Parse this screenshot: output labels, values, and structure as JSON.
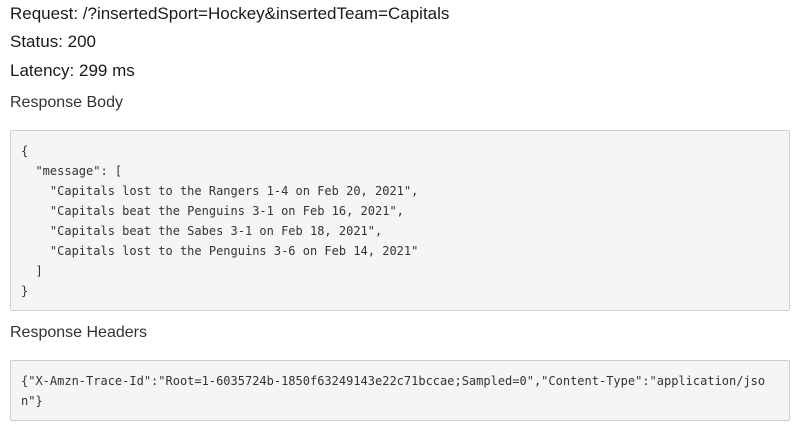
{
  "request": {
    "label": "Request: /?insertedSport=Hockey&insertedTeam=Capitals"
  },
  "status": {
    "label": "Status: 200"
  },
  "latency": {
    "label": "Latency: 299 ms"
  },
  "response_body": {
    "title": "Response Body",
    "code": "{\n  \"message\": [\n    \"Capitals lost to the Rangers 1-4 on Feb 20, 2021\",\n    \"Capitals beat the Penguins 3-1 on Feb 16, 2021\",\n    \"Capitals beat the Sabes 3-1 on Feb 18, 2021\",\n    \"Capitals lost to the Penguins 3-6 on Feb 14, 2021\"\n  ]\n}"
  },
  "response_headers": {
    "title": "Response Headers",
    "code": "{\"X-Amzn-Trace-Id\":\"Root=1-6035724b-1850f63249143e22c71bccae;Sampled=0\",\"Content-Type\":\"application/json\"}"
  }
}
